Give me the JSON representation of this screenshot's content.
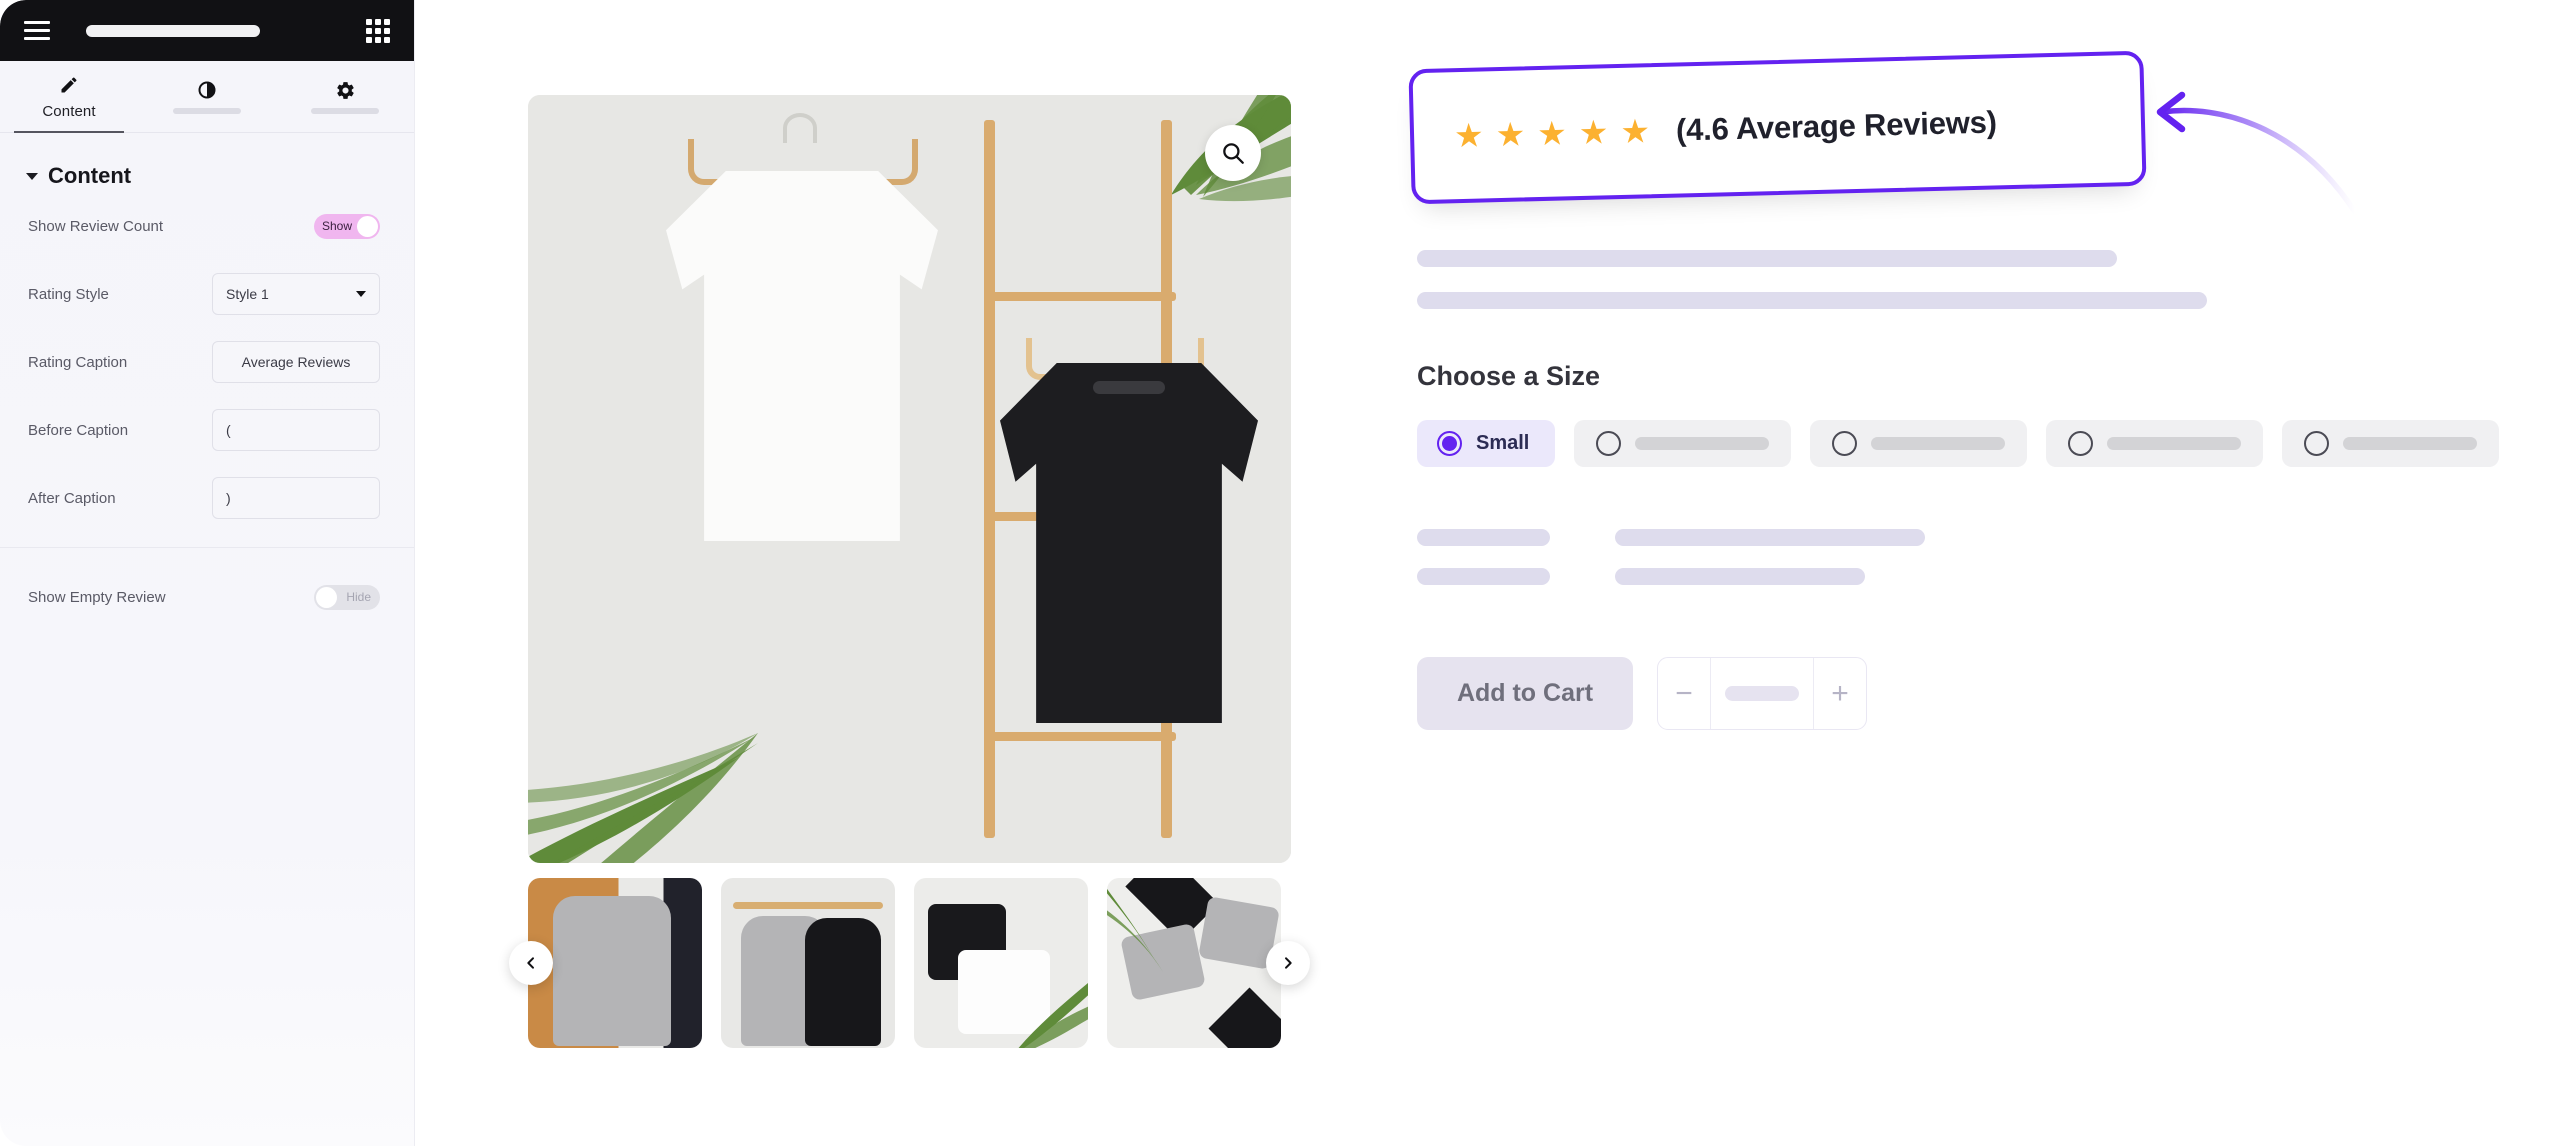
{
  "panel": {
    "topbar": {
      "menu_icon": "hamburger-menu-icon",
      "apps_icon": "grid-apps-icon"
    },
    "tabs": [
      {
        "label": "Content",
        "icon": "pencil-icon",
        "active": true
      },
      {
        "label": "",
        "icon": "half-circle-style-icon",
        "active": false
      },
      {
        "label": "",
        "icon": "gear-icon",
        "active": false
      }
    ],
    "section": {
      "title": "Content",
      "collapse_icon": "caret-down-icon"
    },
    "fields": [
      {
        "label": "Show Review Count",
        "type": "toggle",
        "state": "on",
        "value": "Show"
      },
      {
        "label": "Rating Style",
        "type": "select",
        "value": "Style 1",
        "icon": "chevron-down-icon"
      },
      {
        "label": "Rating Caption",
        "type": "text",
        "value": "Average Reviews"
      },
      {
        "label": "Before Caption",
        "type": "text",
        "value": "("
      },
      {
        "label": "After Caption",
        "type": "text",
        "value": ")"
      },
      {
        "label": "Show Empty Review",
        "type": "toggle",
        "state": "off",
        "value": "Hide"
      }
    ]
  },
  "canvas": {
    "gallery": {
      "zoom_icon": "magnifier-search-icon",
      "prev_icon": "chevron-left-icon",
      "next_icon": "chevron-right-icon",
      "thumbnails": [
        {
          "name": "thumbnail-grey-tshirt-orange-board"
        },
        {
          "name": "thumbnail-grey-and-black-tshirts-rail"
        },
        {
          "name": "thumbnail-folded-white-and-black-tshirts"
        },
        {
          "name": "thumbnail-folded-grey-tshirts-flatlay"
        }
      ]
    },
    "rating": {
      "stars_count": 5,
      "star_glyph": "★",
      "caption": "(4.6 Average Reviews)",
      "highlight_color": "#6322f0",
      "star_color": "#fcb130"
    },
    "annotation": {
      "arrow_icon": "curved-arrow-left-icon",
      "color": "#6322f0"
    },
    "size_section": {
      "title": "Choose a Size",
      "options": [
        {
          "label": "Small",
          "selected": true
        },
        {
          "label": "",
          "selected": false
        },
        {
          "label": "",
          "selected": false
        },
        {
          "label": "",
          "selected": false
        },
        {
          "label": "",
          "selected": false
        }
      ]
    },
    "cart": {
      "add_label": "Add to Cart",
      "minus_label": "−",
      "plus_label": "+"
    }
  }
}
